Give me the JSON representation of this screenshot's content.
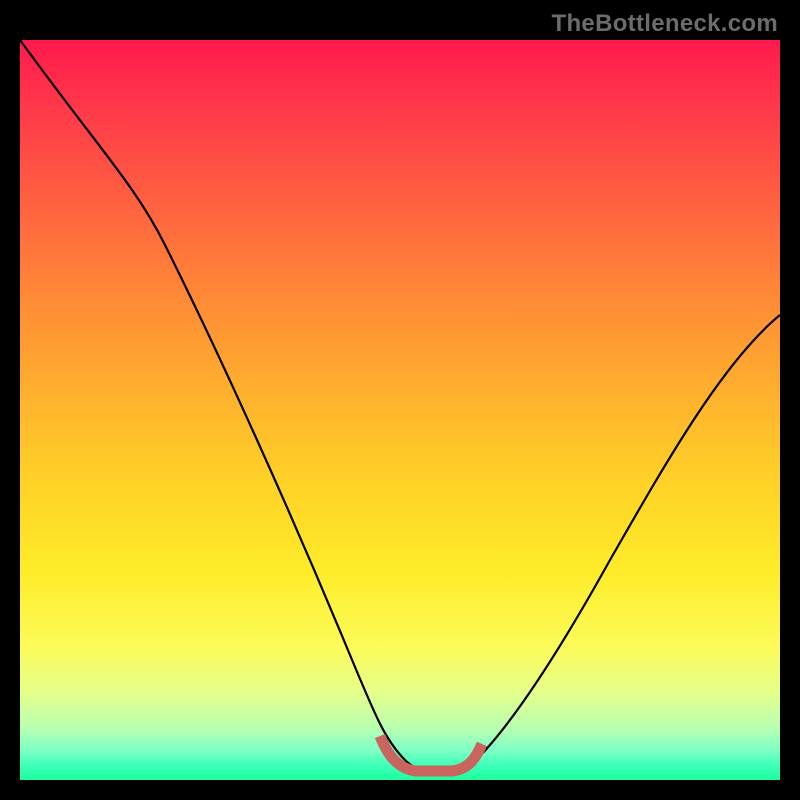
{
  "watermark": "TheBottleneck.com",
  "colors": {
    "frame": "#000000",
    "curve": "#000000",
    "marker": "#c9645e",
    "gradient_top": "#ff1a4d",
    "gradient_bottom": "#1cff9d"
  },
  "chart_data": {
    "type": "line",
    "title": "",
    "xlabel": "",
    "ylabel": "",
    "xlim": [
      0,
      100
    ],
    "ylim": [
      0,
      100
    ],
    "grid": false,
    "legend": false,
    "series": [
      {
        "name": "bottleneck-curve",
        "x": [
          0,
          5,
          10,
          15,
          20,
          25,
          30,
          35,
          40,
          45,
          48,
          50,
          52,
          55,
          57,
          60,
          65,
          70,
          75,
          80,
          85,
          90,
          95,
          100
        ],
        "y": [
          100,
          92,
          82,
          73,
          64,
          55,
          45,
          35,
          25,
          14,
          7,
          3,
          1,
          1,
          1,
          2,
          6,
          13,
          21,
          30,
          39,
          48,
          56,
          63
        ]
      }
    ],
    "annotations": [
      {
        "name": "optimal-range-marker",
        "x_start": 48,
        "x_end": 60,
        "y": 1
      }
    ]
  }
}
